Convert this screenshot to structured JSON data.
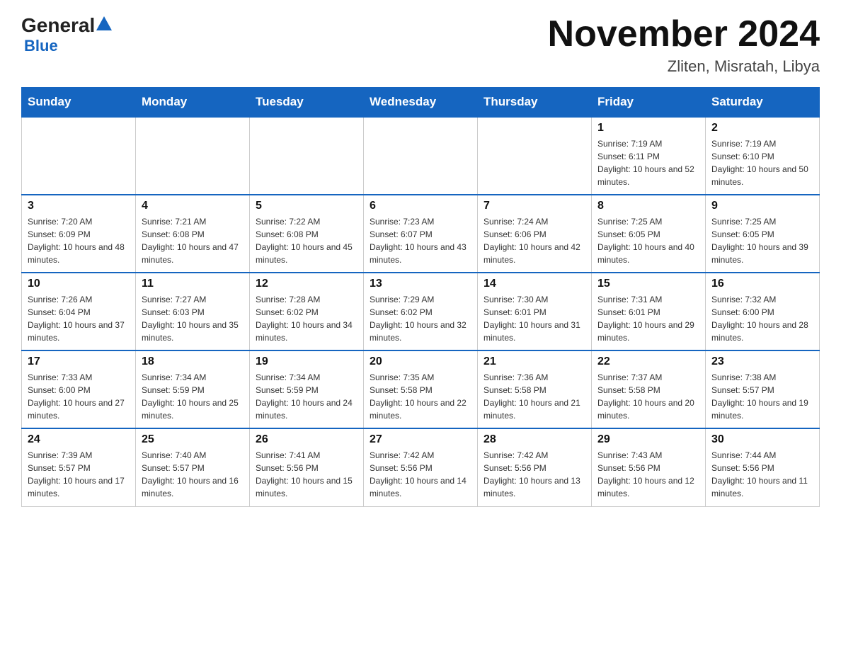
{
  "logo": {
    "general": "General",
    "triangle": "▲",
    "blue": "Blue"
  },
  "header": {
    "title": "November 2024",
    "subtitle": "Zliten, Misratah, Libya"
  },
  "weekdays": [
    "Sunday",
    "Monday",
    "Tuesday",
    "Wednesday",
    "Thursday",
    "Friday",
    "Saturday"
  ],
  "weeks": [
    [
      {
        "day": "",
        "sunrise": "",
        "sunset": "",
        "daylight": ""
      },
      {
        "day": "",
        "sunrise": "",
        "sunset": "",
        "daylight": ""
      },
      {
        "day": "",
        "sunrise": "",
        "sunset": "",
        "daylight": ""
      },
      {
        "day": "",
        "sunrise": "",
        "sunset": "",
        "daylight": ""
      },
      {
        "day": "",
        "sunrise": "",
        "sunset": "",
        "daylight": ""
      },
      {
        "day": "1",
        "sunrise": "Sunrise: 7:19 AM",
        "sunset": "Sunset: 6:11 PM",
        "daylight": "Daylight: 10 hours and 52 minutes."
      },
      {
        "day": "2",
        "sunrise": "Sunrise: 7:19 AM",
        "sunset": "Sunset: 6:10 PM",
        "daylight": "Daylight: 10 hours and 50 minutes."
      }
    ],
    [
      {
        "day": "3",
        "sunrise": "Sunrise: 7:20 AM",
        "sunset": "Sunset: 6:09 PM",
        "daylight": "Daylight: 10 hours and 48 minutes."
      },
      {
        "day": "4",
        "sunrise": "Sunrise: 7:21 AM",
        "sunset": "Sunset: 6:08 PM",
        "daylight": "Daylight: 10 hours and 47 minutes."
      },
      {
        "day": "5",
        "sunrise": "Sunrise: 7:22 AM",
        "sunset": "Sunset: 6:08 PM",
        "daylight": "Daylight: 10 hours and 45 minutes."
      },
      {
        "day": "6",
        "sunrise": "Sunrise: 7:23 AM",
        "sunset": "Sunset: 6:07 PM",
        "daylight": "Daylight: 10 hours and 43 minutes."
      },
      {
        "day": "7",
        "sunrise": "Sunrise: 7:24 AM",
        "sunset": "Sunset: 6:06 PM",
        "daylight": "Daylight: 10 hours and 42 minutes."
      },
      {
        "day": "8",
        "sunrise": "Sunrise: 7:25 AM",
        "sunset": "Sunset: 6:05 PM",
        "daylight": "Daylight: 10 hours and 40 minutes."
      },
      {
        "day": "9",
        "sunrise": "Sunrise: 7:25 AM",
        "sunset": "Sunset: 6:05 PM",
        "daylight": "Daylight: 10 hours and 39 minutes."
      }
    ],
    [
      {
        "day": "10",
        "sunrise": "Sunrise: 7:26 AM",
        "sunset": "Sunset: 6:04 PM",
        "daylight": "Daylight: 10 hours and 37 minutes."
      },
      {
        "day": "11",
        "sunrise": "Sunrise: 7:27 AM",
        "sunset": "Sunset: 6:03 PM",
        "daylight": "Daylight: 10 hours and 35 minutes."
      },
      {
        "day": "12",
        "sunrise": "Sunrise: 7:28 AM",
        "sunset": "Sunset: 6:02 PM",
        "daylight": "Daylight: 10 hours and 34 minutes."
      },
      {
        "day": "13",
        "sunrise": "Sunrise: 7:29 AM",
        "sunset": "Sunset: 6:02 PM",
        "daylight": "Daylight: 10 hours and 32 minutes."
      },
      {
        "day": "14",
        "sunrise": "Sunrise: 7:30 AM",
        "sunset": "Sunset: 6:01 PM",
        "daylight": "Daylight: 10 hours and 31 minutes."
      },
      {
        "day": "15",
        "sunrise": "Sunrise: 7:31 AM",
        "sunset": "Sunset: 6:01 PM",
        "daylight": "Daylight: 10 hours and 29 minutes."
      },
      {
        "day": "16",
        "sunrise": "Sunrise: 7:32 AM",
        "sunset": "Sunset: 6:00 PM",
        "daylight": "Daylight: 10 hours and 28 minutes."
      }
    ],
    [
      {
        "day": "17",
        "sunrise": "Sunrise: 7:33 AM",
        "sunset": "Sunset: 6:00 PM",
        "daylight": "Daylight: 10 hours and 27 minutes."
      },
      {
        "day": "18",
        "sunrise": "Sunrise: 7:34 AM",
        "sunset": "Sunset: 5:59 PM",
        "daylight": "Daylight: 10 hours and 25 minutes."
      },
      {
        "day": "19",
        "sunrise": "Sunrise: 7:34 AM",
        "sunset": "Sunset: 5:59 PM",
        "daylight": "Daylight: 10 hours and 24 minutes."
      },
      {
        "day": "20",
        "sunrise": "Sunrise: 7:35 AM",
        "sunset": "Sunset: 5:58 PM",
        "daylight": "Daylight: 10 hours and 22 minutes."
      },
      {
        "day": "21",
        "sunrise": "Sunrise: 7:36 AM",
        "sunset": "Sunset: 5:58 PM",
        "daylight": "Daylight: 10 hours and 21 minutes."
      },
      {
        "day": "22",
        "sunrise": "Sunrise: 7:37 AM",
        "sunset": "Sunset: 5:58 PM",
        "daylight": "Daylight: 10 hours and 20 minutes."
      },
      {
        "day": "23",
        "sunrise": "Sunrise: 7:38 AM",
        "sunset": "Sunset: 5:57 PM",
        "daylight": "Daylight: 10 hours and 19 minutes."
      }
    ],
    [
      {
        "day": "24",
        "sunrise": "Sunrise: 7:39 AM",
        "sunset": "Sunset: 5:57 PM",
        "daylight": "Daylight: 10 hours and 17 minutes."
      },
      {
        "day": "25",
        "sunrise": "Sunrise: 7:40 AM",
        "sunset": "Sunset: 5:57 PM",
        "daylight": "Daylight: 10 hours and 16 minutes."
      },
      {
        "day": "26",
        "sunrise": "Sunrise: 7:41 AM",
        "sunset": "Sunset: 5:56 PM",
        "daylight": "Daylight: 10 hours and 15 minutes."
      },
      {
        "day": "27",
        "sunrise": "Sunrise: 7:42 AM",
        "sunset": "Sunset: 5:56 PM",
        "daylight": "Daylight: 10 hours and 14 minutes."
      },
      {
        "day": "28",
        "sunrise": "Sunrise: 7:42 AM",
        "sunset": "Sunset: 5:56 PM",
        "daylight": "Daylight: 10 hours and 13 minutes."
      },
      {
        "day": "29",
        "sunrise": "Sunrise: 7:43 AM",
        "sunset": "Sunset: 5:56 PM",
        "daylight": "Daylight: 10 hours and 12 minutes."
      },
      {
        "day": "30",
        "sunrise": "Sunrise: 7:44 AM",
        "sunset": "Sunset: 5:56 PM",
        "daylight": "Daylight: 10 hours and 11 minutes."
      }
    ]
  ]
}
